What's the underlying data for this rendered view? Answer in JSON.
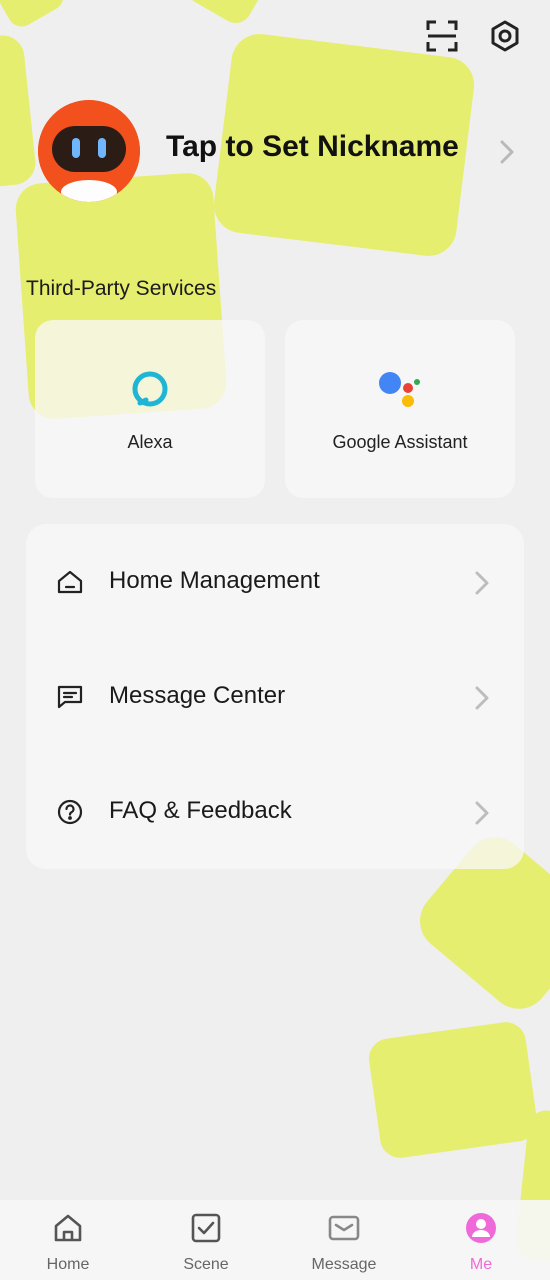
{
  "profile": {
    "nickname": "Tap to Set Nickname"
  },
  "header": {
    "scan_icon": "scan-icon",
    "settings_icon": "settings-hex-icon"
  },
  "third_party": {
    "title": "Third-Party Services",
    "services": [
      {
        "label": "Alexa",
        "icon": "alexa-icon"
      },
      {
        "label": "Google Assistant",
        "icon": "google-assistant-icon"
      }
    ]
  },
  "menu": {
    "items": [
      {
        "label": "Home Management",
        "icon": "home-icon"
      },
      {
        "label": "Message Center",
        "icon": "message-icon"
      },
      {
        "label": "FAQ & Feedback",
        "icon": "help-icon"
      }
    ]
  },
  "tabbar": {
    "tabs": [
      {
        "label": "Home",
        "icon": "home-tab-icon",
        "active": false
      },
      {
        "label": "Scene",
        "icon": "scene-tab-icon",
        "active": false
      },
      {
        "label": "Message",
        "icon": "message-tab-icon",
        "active": false
      },
      {
        "label": "Me",
        "icon": "me-tab-icon",
        "active": true
      }
    ]
  },
  "colors": {
    "accent": "#ef6ad8",
    "decor": "#e6ee6f",
    "avatar": "#f2501c",
    "alexa": "#1fb5d4"
  }
}
